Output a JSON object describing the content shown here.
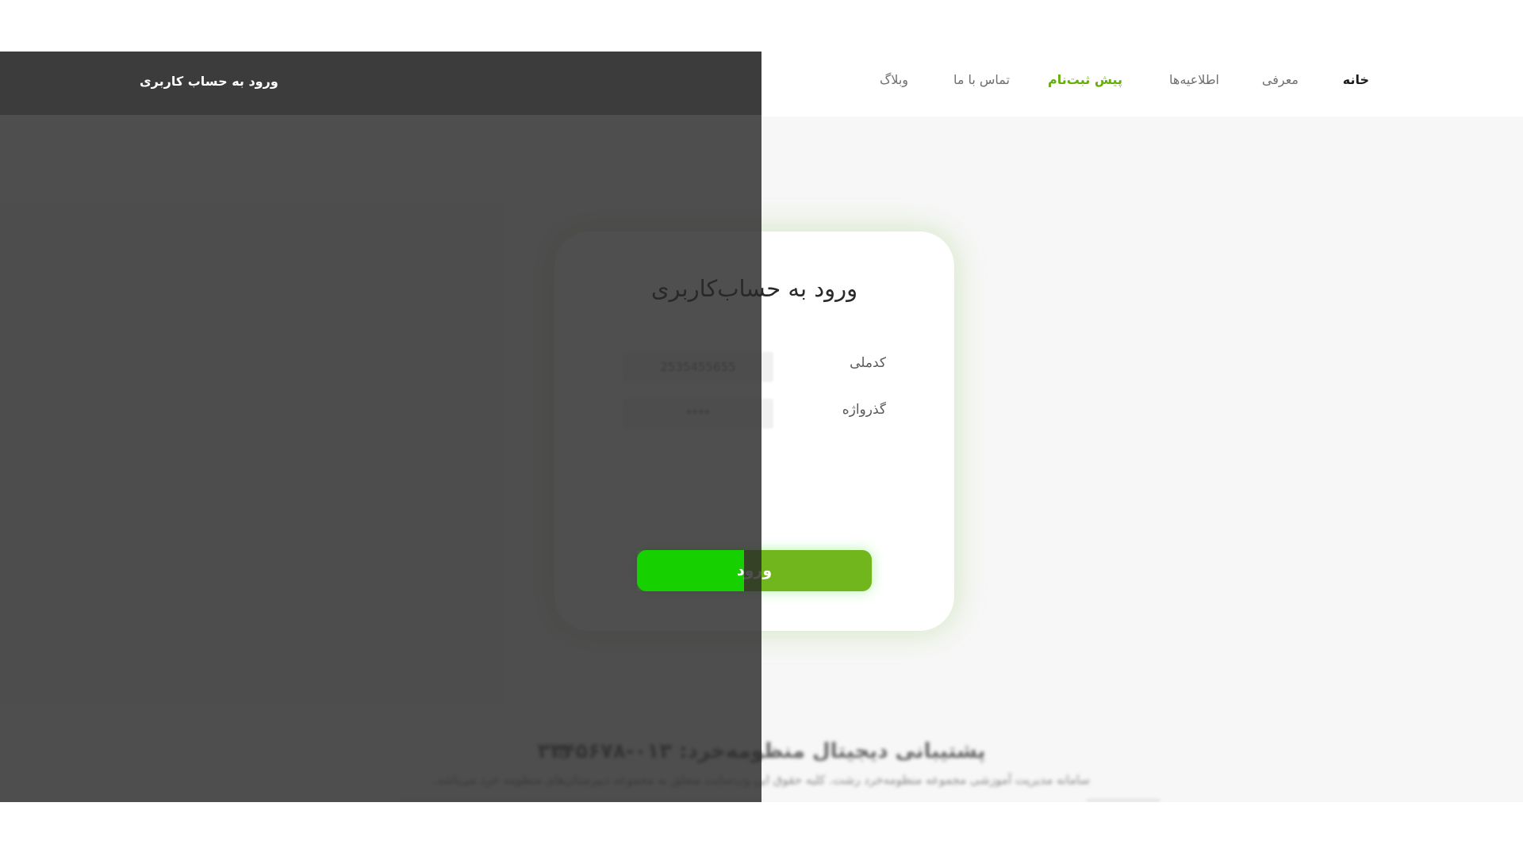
{
  "navbar": {
    "items": [
      {
        "label": "خانه",
        "state": "active"
      },
      {
        "label": "معرفی"
      },
      {
        "label": "اطلاعیه‌ها"
      },
      {
        "label": "پیش ثبت‌نام",
        "state": "highlighted"
      },
      {
        "label": "تماس با ما"
      },
      {
        "label": "وبلاگ"
      }
    ]
  },
  "overlay": {
    "header_title": "ورود به حساب کاربری"
  },
  "login_form": {
    "title": "ورود به حساب‌کاربری",
    "national_code": {
      "label": "کدملی",
      "value": "2535455655"
    },
    "password": {
      "label": "گذرواژه",
      "value": "****"
    },
    "submit_label": "ورود"
  },
  "footer": {
    "support_text": "پشتیبانی دیجیتال منظومه‌خرد: ۰۱۳-۳۳۴۵۶۷۸",
    "note": "سامانه مدیریت آموزشی مجموعه منظومه‌خرد رشت. کلیه حقوق این وب‌سایت متعلق به مجموعه دبیرستان‌های منظومه خرد می‌باشد."
  },
  "icons": {
    "phone": "phone-icon"
  },
  "colors": {
    "accent_green": "#65ad0a",
    "button_green": "#72b61e",
    "button_active_green": "#17d000",
    "overlay": "#3c3c3c"
  }
}
